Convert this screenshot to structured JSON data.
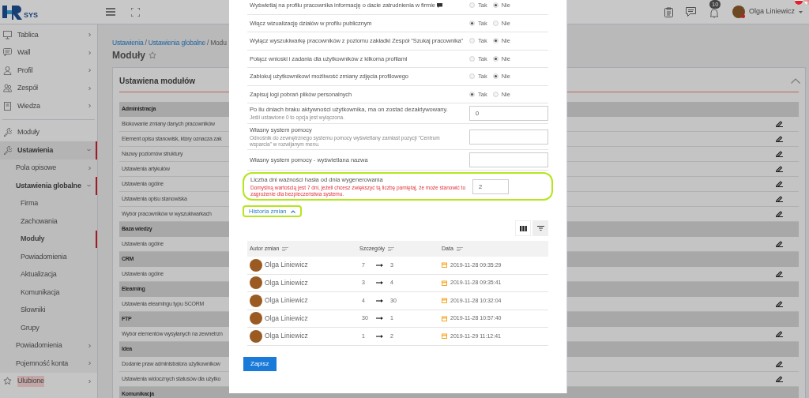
{
  "topbar": {
    "logo_text": "SYS",
    "user_name": "Olga Liniewicz",
    "notification_count": "10"
  },
  "sidebar": {
    "items": [
      {
        "label": "Tablica",
        "expanded": false,
        "selected": false
      },
      {
        "label": "Wall",
        "expanded": false,
        "selected": false
      },
      {
        "label": "Profil",
        "expanded": false,
        "selected": false
      },
      {
        "label": "Zespół",
        "expanded": false,
        "selected": false
      },
      {
        "label": "Wiedza",
        "expanded": false,
        "selected": false
      },
      {
        "label": "Moduły",
        "selected": false,
        "divider_before": true
      },
      {
        "label": "Ustawienia",
        "expanded": true,
        "selected": false,
        "children": [
          {
            "label": "Pola opisowe",
            "expanded": false,
            "selected": false
          },
          {
            "label": "Ustawienia globalne",
            "expanded": true,
            "selected": false,
            "children": [
              {
                "label": "Firma",
                "selected": false
              },
              {
                "label": "Zachowania",
                "selected": false
              },
              {
                "label": "Moduły",
                "selected": true
              },
              {
                "label": "Powiadomienia",
                "selected": false
              },
              {
                "label": "Aktualizacja",
                "selected": false
              },
              {
                "label": "Komunikacja",
                "selected": false
              },
              {
                "label": "Słowniki",
                "selected": false
              },
              {
                "label": "Grupy",
                "selected": false
              }
            ]
          },
          {
            "label": "Powiadomienia",
            "expanded": false,
            "selected": false
          },
          {
            "label": "Pojemność konta",
            "expanded": false,
            "selected": false
          }
        ]
      },
      {
        "label": "Ulubione",
        "expanded": false,
        "selected": false
      }
    ]
  },
  "breadcrumb": [
    {
      "label": "Ustawienia",
      "kind": "link"
    },
    {
      "separator": "/",
      "label": "Ustawienia globalne",
      "kind": "link"
    },
    {
      "separator": "/",
      "label": "Modu",
      "kind": "current"
    }
  ],
  "page_title": "Moduły",
  "card": {
    "title": "Ustawiena modułów",
    "rows": [
      {
        "kind": "section",
        "label": "Administracja"
      },
      {
        "kind": "item",
        "label": "Blokowanie zmiany danych pracowników"
      },
      {
        "kind": "item",
        "label": "Element opisu stanowisk, który oznacza zak"
      },
      {
        "kind": "item",
        "label": "Nazwy poziomów struktury"
      },
      {
        "kind": "item",
        "label": "Ustawienia artykułów"
      },
      {
        "kind": "item",
        "label": "Ustawienia ogólne"
      },
      {
        "kind": "item",
        "label": "Ustawienia opisu stanowiska"
      },
      {
        "kind": "item",
        "label": "Wybór pracowników w wyszukiwarkach"
      },
      {
        "kind": "section",
        "label": "Baza wiedzy"
      },
      {
        "kind": "item",
        "label": "Ustawienia ogólne"
      },
      {
        "kind": "section",
        "label": "CRM"
      },
      {
        "kind": "item",
        "label": "Ustawienia ogólne"
      },
      {
        "kind": "section",
        "label": "Elearning"
      },
      {
        "kind": "item",
        "label": "Ustawienia elearningu typu SCORM"
      },
      {
        "kind": "section",
        "label": "FTP"
      },
      {
        "kind": "item",
        "label": "Wybór elementów wysyłanych na zewnetrzn"
      },
      {
        "kind": "section",
        "label": "Idea"
      },
      {
        "kind": "item",
        "label": "Dodanie praw administratora użytkownikow"
      },
      {
        "kind": "item",
        "label": "Ustawienia widocznych statusów dla użytko"
      },
      {
        "kind": "section",
        "label": "Komunikacja"
      }
    ]
  },
  "modal": {
    "settings": [
      {
        "kind": "radio",
        "label": "Wyświetlaj na profilu pracownika informację o dacie zatrudnienia w firmie",
        "comment_icon": true,
        "options": [
          {
            "label": "Tak",
            "selected": false
          },
          {
            "label": "Nie",
            "selected": true
          }
        ]
      },
      {
        "kind": "radio",
        "label": "Włącz wizualizację działów w profilu publicznym",
        "options": [
          {
            "label": "Tak",
            "selected": true
          },
          {
            "label": "Nie",
            "selected": false
          }
        ]
      },
      {
        "kind": "radio",
        "label": "Wyłącz wyszukiwarkę pracowników z poziomu zakładki Zespół \"Szukaj pracownika\"",
        "options": [
          {
            "label": "Tak",
            "selected": false
          },
          {
            "label": "Nie",
            "selected": true
          }
        ]
      },
      {
        "kind": "radio",
        "label": "Połącz wnioski i zadania dla użytkowników z kilkoma profilami",
        "options": [
          {
            "label": "Tak",
            "selected": false
          },
          {
            "label": "Nie",
            "selected": true
          }
        ]
      },
      {
        "kind": "radio",
        "label": "Zablokuj użytkownikowi możliwość zmiany zdjęcia profilowego",
        "options": [
          {
            "label": "Tak",
            "selected": false
          },
          {
            "label": "Nie",
            "selected": true
          }
        ]
      },
      {
        "kind": "radio",
        "label": "Zapisuj logi pobrań plików personalnych",
        "options": [
          {
            "label": "Tak",
            "selected": true
          },
          {
            "label": "Nie",
            "selected": false
          }
        ]
      },
      {
        "kind": "input",
        "label": "Po ilu dniach braku aktywności użytkownika, ma on zostać dezaktywowany.",
        "hint": "Jeśli ustawione 0 to opcja jest wyłączona.",
        "warning": false,
        "highlighted": false,
        "value": "0"
      },
      {
        "kind": "input",
        "label": "Własny system pomocy",
        "hint": "Odnośnik do zewnętrznego systemu pomocy wyświetlany zamiast pozycji \"Centrum wsparcia\" w rozwijanym menu.",
        "warning": false,
        "highlighted": false
      },
      {
        "kind": "input",
        "label": "Własny system pomocy - wyświetlana nazwa",
        "highlighted": false
      },
      {
        "kind": "input",
        "label": "Liczba dni ważności hasła od dnia wygenerowania",
        "hint": "Domyślną wartością jest 7 dni, jeżeli chcesz zwiększyć tą liczbę pamiętaj, że może stanowić to zagrożenie dla bezpieczeństwa systemu.",
        "warning": true,
        "highlighted": true,
        "value": "2"
      }
    ],
    "history": {
      "toggle": {
        "label": "Historia zmian",
        "expanded": true,
        "highlighted": true
      },
      "columns": [
        "Autor zmian",
        "Szczegóły",
        "Data"
      ],
      "rows": [
        {
          "author": "Olga Liniewicz",
          "from": "7",
          "to": "3",
          "date": "2019-11-28 09:35:29"
        },
        {
          "author": "Olga Liniewicz",
          "from": "3",
          "to": "4",
          "date": "2019-11-28 09:35:41"
        },
        {
          "author": "Olga Liniewicz",
          "from": "4",
          "to": "30",
          "date": "2019-11-28 10:32:04"
        },
        {
          "author": "Olga Liniewicz",
          "from": "30",
          "to": "1",
          "date": "2019-11-28 10:57:40"
        },
        {
          "author": "Olga Liniewicz",
          "from": "1",
          "to": "2",
          "date": "2019-11-29 11:12:41"
        }
      ]
    },
    "save_button": "Zapisz"
  }
}
